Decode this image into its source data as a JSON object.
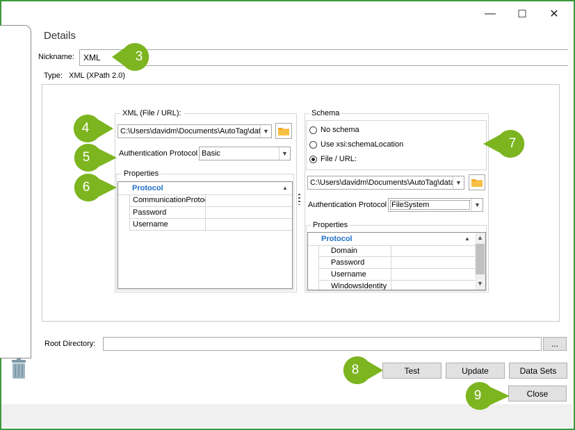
{
  "window": {
    "minimize_glyph": "—",
    "maximize_glyph": "☐",
    "close_glyph": "✕"
  },
  "details": {
    "title": "Details",
    "nickname_label": "Nickname:",
    "nickname_value": "XML",
    "type_label": "Type:",
    "type_value": "XML (XPath 2.0)"
  },
  "xml_group": {
    "title": "XML (File / URL):",
    "path": "C:\\Users\\davidm\\Documents\\AutoTag\\data",
    "auth_label": "Authentication Protocol",
    "auth_value": "Basic",
    "properties_title": "Properties",
    "category": "Protocol",
    "rows": [
      "CommunicationProtocol",
      "Password",
      "Username"
    ]
  },
  "schema_group": {
    "title": "Schema",
    "options": [
      "No schema",
      "Use xsi:schemaLocation",
      "File / URL:"
    ],
    "selected_index": 2,
    "path": "C:\\Users\\davidm\\Documents\\AutoTag\\data",
    "auth_label": "Authentication Protocol",
    "auth_value": "FileSystem",
    "properties_title": "Properties",
    "category": "Protocol",
    "rows": [
      "Domain",
      "Password",
      "Username",
      "WindowsIdentity"
    ]
  },
  "root_directory": {
    "label": "Root Directory:",
    "value": "",
    "browse_label": "..."
  },
  "buttons": {
    "test": "Test",
    "update": "Update",
    "data_sets": "Data Sets",
    "close": "Close"
  },
  "callouts": {
    "c3": "3",
    "c4": "4",
    "c5": "5",
    "c6": "6",
    "c7": "7",
    "c8": "8",
    "c9": "9"
  },
  "colors": {
    "callout_green": "#7cb51f",
    "category_blue": "#1e6fc7",
    "window_border": "#3a9a3a"
  },
  "icons": {
    "trash": "trash-icon",
    "folder": "folder-icon"
  }
}
